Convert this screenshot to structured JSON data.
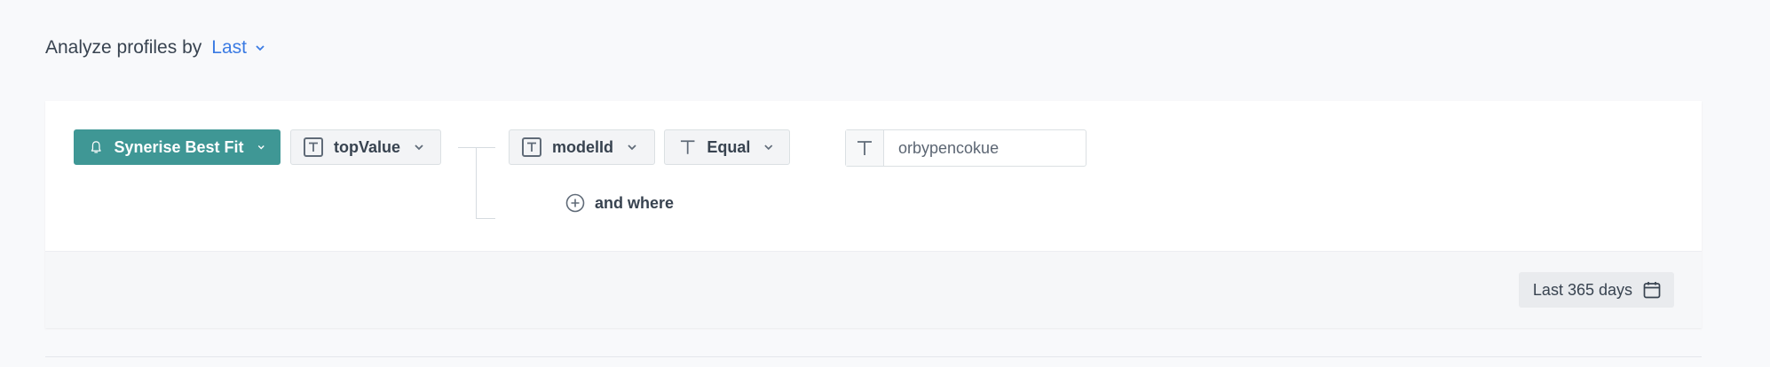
{
  "header": {
    "label": "Analyze profiles by",
    "mode_value": "Last"
  },
  "filter": {
    "model_button": {
      "label": "Synerise Best Fit",
      "icon": "bell-icon"
    },
    "attribute": {
      "label": "topValue",
      "icon": "text-type-icon"
    },
    "condition": {
      "parameter": {
        "label": "modelId",
        "icon": "text-type-icon"
      },
      "operator": {
        "label": "Equal",
        "icon": "text-t-icon"
      },
      "value": {
        "text": "orbypencokue",
        "icon": "text-t-icon"
      }
    },
    "add_condition_label": "and where"
  },
  "footer": {
    "date_range_label": "Last 365 days",
    "date_icon": "calendar-icon"
  },
  "colors": {
    "primary": "#3f9795",
    "link": "#3b7be3",
    "text": "#384350"
  }
}
